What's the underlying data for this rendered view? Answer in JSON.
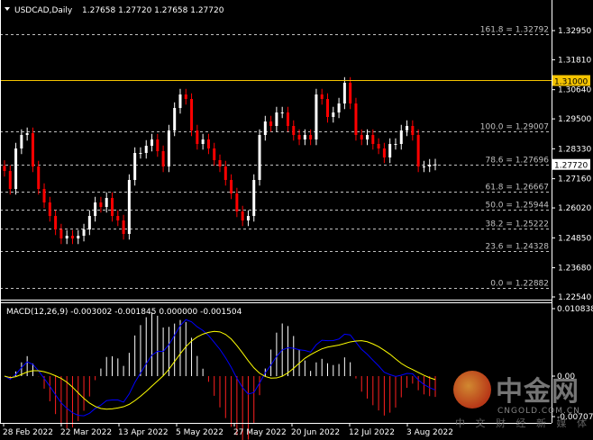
{
  "header": {
    "symbol": "USDCAD,Daily",
    "ohlc_readout": "1.27658 1.27720 1.27658 1.27720"
  },
  "colors": {
    "background": "#000000",
    "bull": "#ffffff",
    "bear": "#ff0000",
    "level_line": "#f5c400",
    "macd_line": "#0000ff",
    "signal_line": "#ffff00",
    "grid": "#c0c0c0"
  },
  "price_axis": {
    "ticks": [
      "1.32950",
      "1.31810",
      "1.30640",
      "1.29500",
      "1.28330",
      "1.27160",
      "1.26020",
      "1.24850",
      "1.23680",
      "1.22540"
    ],
    "range": [
      1.2254,
      1.3295
    ],
    "horizontal_line": {
      "value": 1.31,
      "label": "1.31000"
    },
    "current_price": {
      "value": 1.2772,
      "label": "1.27720"
    }
  },
  "fibonacci": [
    {
      "label": "161.8 = 1.32792",
      "value": 1.32792
    },
    {
      "label": "100.0 = 1.29007",
      "value": 1.29007
    },
    {
      "label": "78.6 = 1.27696",
      "value": 1.27696
    },
    {
      "label": "61.8 = 1.26667",
      "value": 1.26667
    },
    {
      "label": "50.0 = 1.25944",
      "value": 1.25944
    },
    {
      "label": "38.2 = 1.25222",
      "value": 1.25222
    },
    {
      "label": "23.6 = 1.24328",
      "value": 1.24328
    },
    {
      "label": "0.0 = 1.22882",
      "value": 1.22882
    }
  ],
  "closes": [
    1.27463,
    1.2676,
    1.28343,
    1.2887,
    1.28941,
    1.27639,
    1.2676,
    1.26233,
    1.25705,
    1.25177,
    1.24826,
    1.24931,
    1.24826,
    1.24931,
    1.25177,
    1.25705,
    1.26233,
    1.26057,
    1.26408,
    1.25705,
    1.25529,
    1.25002,
    1.27112,
    1.28167,
    1.28167,
    1.28448,
    1.28694,
    1.28237,
    1.27639,
    1.29046,
    1.29925,
    1.30453,
    1.30277,
    1.29046,
    1.28519,
    1.28694,
    1.28343,
    1.27886,
    1.27639,
    1.27112,
    1.26584,
    1.25881,
    1.25529,
    1.25705,
    1.27112,
    1.2887,
    1.29398,
    1.29222,
    1.2975,
    1.2975,
    1.29222,
    1.2887,
    1.28694,
    1.2887,
    1.28694,
    1.30453,
    1.30277,
    1.29574,
    1.2975,
    1.30101,
    1.3091,
    1.30101,
    1.2887,
    1.28694,
    1.2887,
    1.28519,
    1.28343,
    1.27991,
    1.28519,
    1.28519,
    1.29046,
    1.29222,
    1.2887,
    1.27639,
    1.27639,
    1.2771,
    1.2772
  ],
  "macd": {
    "legend": "MACD(12,26,9) -0.003002 -0.001845 0.000000 -0.001504",
    "axis_ticks": [
      "0.010838",
      "0.00",
      "-0.007072"
    ],
    "range": [
      -0.007072,
      0.010838
    ]
  },
  "time_axis": [
    "28 Feb 2022",
    "22 Mar 2022",
    "13 Apr 2022",
    "5 May 2022",
    "27 May 2022",
    "20 Jun 2022",
    "12 Jul 2022",
    "3 Aug 2022"
  ],
  "watermark": {
    "brand": "中金网",
    "domain": "CNGOLD.COM.CN",
    "slogan": "中 文 财 经 新 媒 体"
  }
}
